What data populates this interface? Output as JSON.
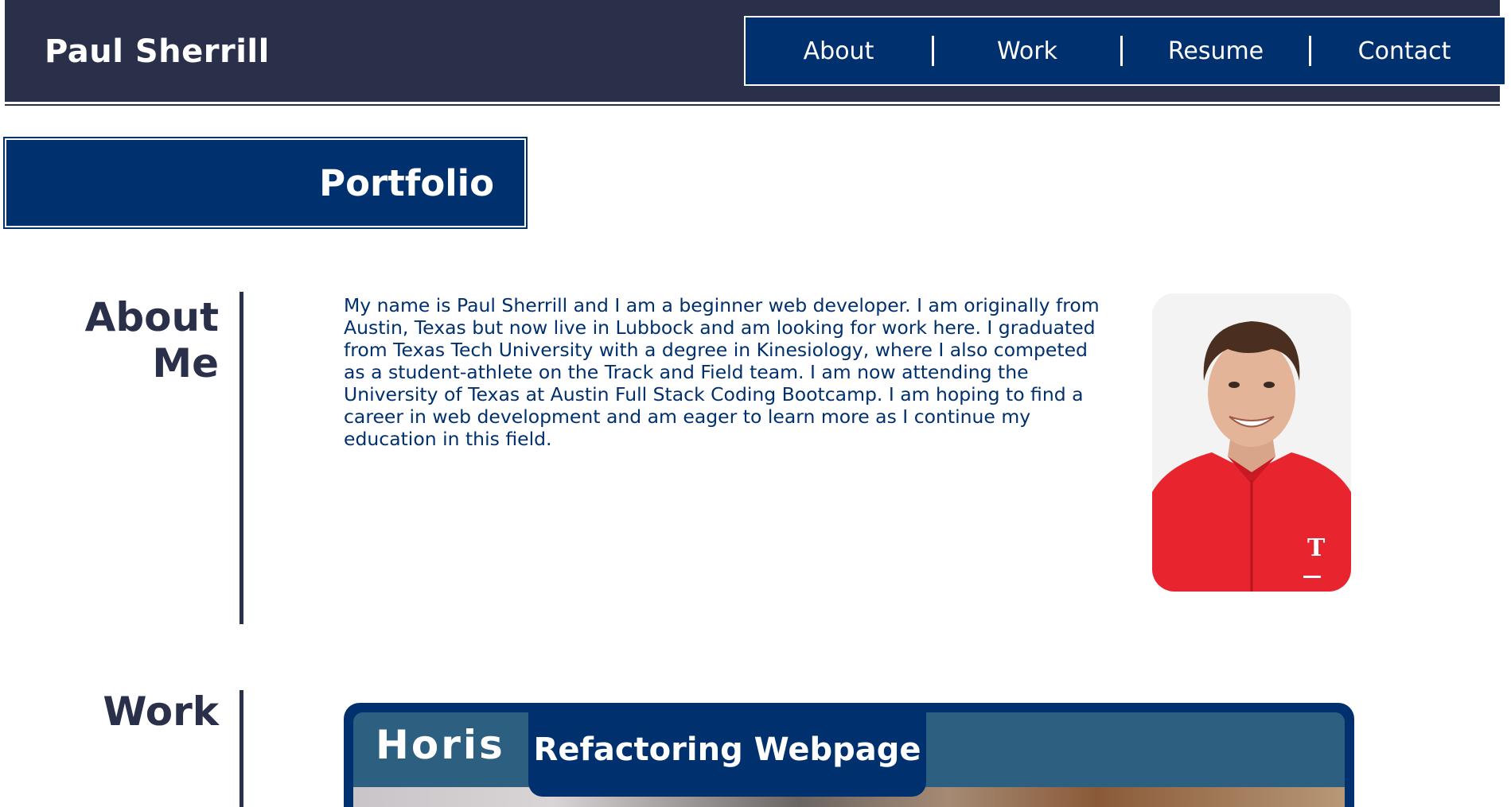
{
  "header": {
    "brand": "Paul Sherrill",
    "nav": [
      "About",
      "Work",
      "Resume",
      "Contact"
    ]
  },
  "banner": {
    "title": "Portfolio"
  },
  "about": {
    "heading_line1": "About",
    "heading_line2": "Me",
    "text": "My name is Paul Sherrill and I am a beginner web developer. I am originally from Austin, Texas but now live in Lubbock and am looking for work here. I graduated from Texas Tech University with a degree in Kinesiology, where I also competed as a student-athlete on the Track and Field team. I am now attending the University of Texas at Austin Full Stack Coding Bootcamp. I am hoping to find a career in web development and am eager to learn more as I continue my education in this field."
  },
  "work": {
    "heading": "Work",
    "project_label": "Refactoring Webpage",
    "screenshot_title": "Horis"
  },
  "colors": {
    "header_bg": "#2a2f4a",
    "accent_navy": "#00306e",
    "text_dark": "#2a2f4a",
    "white": "#ffffff"
  }
}
